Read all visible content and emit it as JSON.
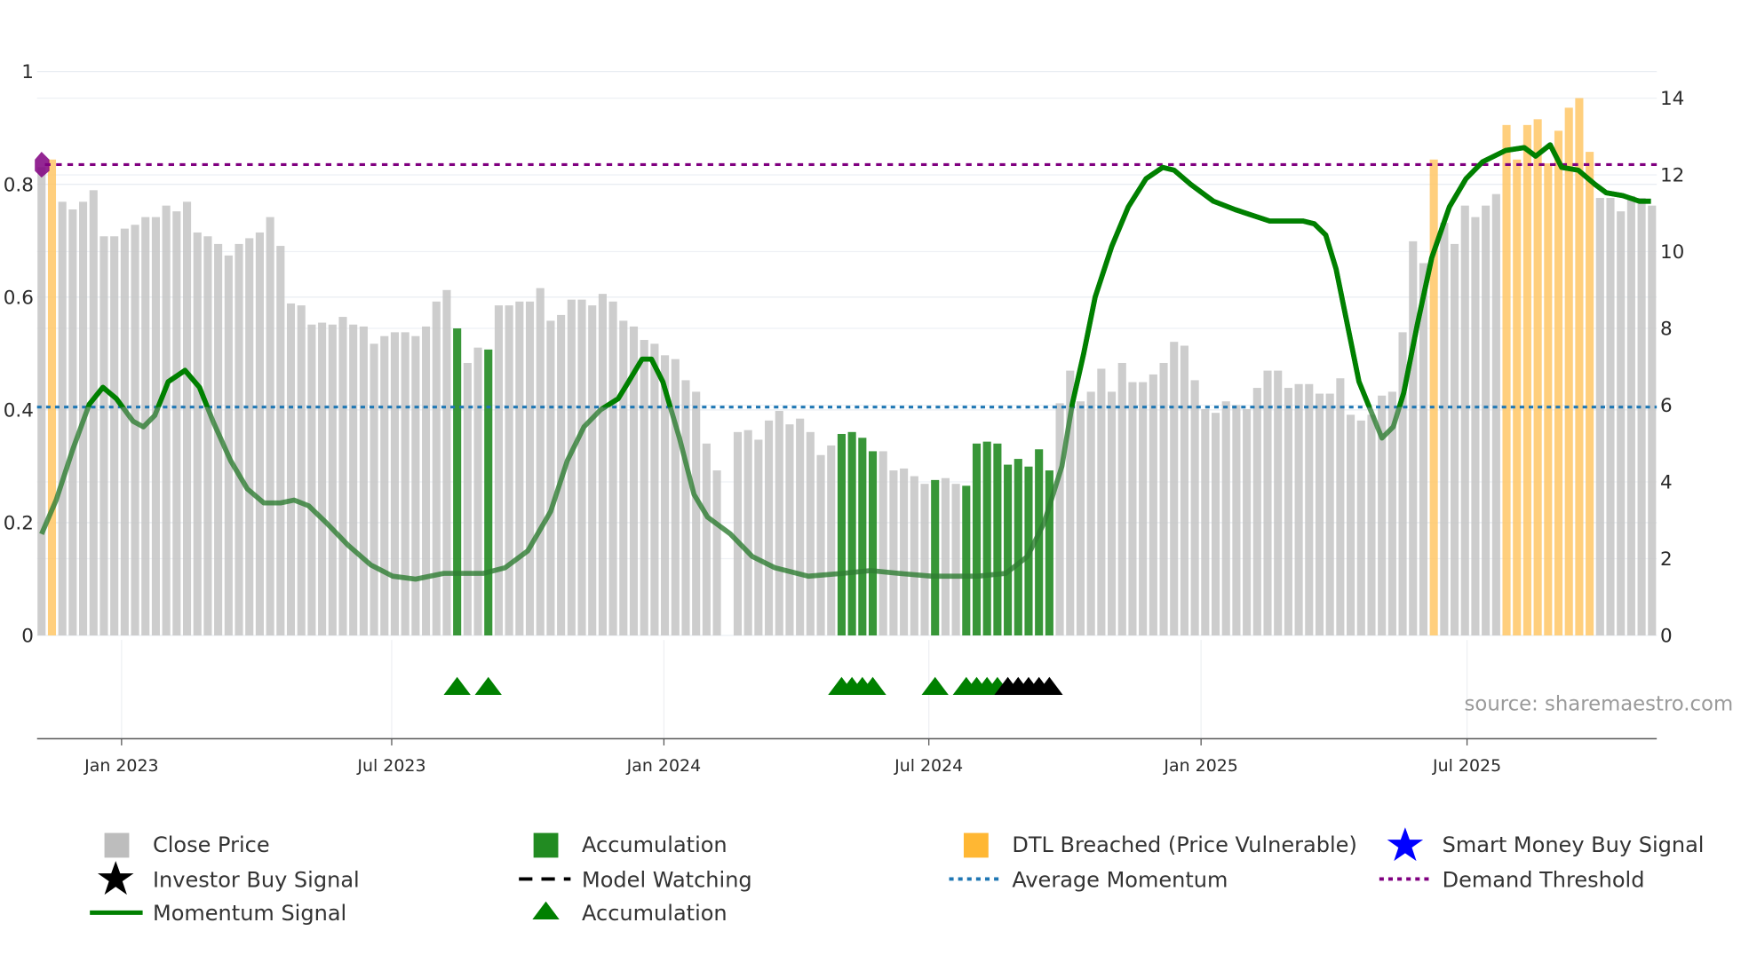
{
  "chart_data": {
    "type": "bar",
    "title": "",
    "x_unit": "week index",
    "left_axis": {
      "ticks": [
        "0",
        "0.2",
        "0.4",
        "0.6",
        "0.8",
        "1"
      ],
      "values": [
        0,
        0.2,
        0.4,
        0.6,
        0.8,
        1
      ],
      "range": [
        0,
        1
      ]
    },
    "right_axis": {
      "ticks": [
        "0",
        "2",
        "4",
        "6",
        "8",
        "10",
        "12",
        "14"
      ],
      "values": [
        0,
        2,
        4,
        6,
        8,
        10,
        12,
        14
      ],
      "range": [
        0,
        14.7
      ]
    },
    "x_ticks": [
      {
        "label": "Jan 2023",
        "x": 7.7
      },
      {
        "label": "Jul 2023",
        "x": 33.7
      },
      {
        "label": "Jan 2024",
        "x": 59.9
      },
      {
        "label": "Jul 2024",
        "x": 85.4
      },
      {
        "label": "Jan 2025",
        "x": 111.6
      },
      {
        "label": "Jul 2025",
        "x": 137.2
      }
    ],
    "close_price": [
      12.2,
      12.4,
      11.3,
      11.1,
      11.3,
      11.6,
      10.4,
      10.4,
      10.6,
      10.7,
      10.9,
      10.9,
      11.2,
      11.05,
      11.3,
      10.5,
      10.4,
      10.2,
      9.9,
      10.2,
      10.35,
      10.5,
      10.9,
      10.15,
      8.65,
      8.6,
      8.1,
      8.15,
      8.1,
      8.3,
      8.1,
      8.05,
      7.6,
      7.8,
      7.9,
      7.9,
      7.8,
      8.05,
      8.7,
      9.0,
      8.0,
      7.1,
      7.5,
      7.45,
      8.6,
      8.6,
      8.7,
      8.7,
      9.05,
      8.2,
      8.35,
      8.75,
      8.75,
      8.6,
      8.9,
      8.7,
      8.2,
      8.05,
      7.7,
      7.6,
      7.3,
      7.2,
      6.65,
      6.35,
      5.0,
      4.3,
      null,
      5.3,
      5.35,
      5.1,
      5.6,
      5.85,
      5.5,
      5.65,
      5.3,
      4.7,
      4.95,
      5.25,
      5.3,
      5.15,
      4.8,
      4.8,
      4.3,
      4.35,
      4.15,
      3.95,
      4.05,
      4.1,
      3.95,
      3.9,
      5.0,
      5.05,
      5.0,
      4.45,
      4.6,
      4.4,
      4.85,
      4.3,
      6.05,
      6.9,
      6.1,
      6.35,
      6.95,
      6.35,
      7.1,
      6.6,
      6.6,
      6.8,
      7.1,
      7.65,
      7.55,
      6.65,
      5.9,
      5.8,
      6.1,
      6.0,
      5.9,
      6.45,
      6.9,
      6.9,
      6.45,
      6.55,
      6.55,
      6.3,
      6.3,
      6.7,
      5.75,
      5.6,
      5.75,
      6.25,
      6.35,
      7.9,
      10.27,
      9.7,
      12.4,
      10.75,
      10.2,
      11.2,
      10.9,
      11.2,
      11.5,
      13.3,
      12.4,
      13.3,
      13.45,
      12.3,
      13.15,
      13.75,
      14.0,
      12.6,
      11.4,
      11.4,
      11.05,
      11.45,
      11.4,
      11.2
    ],
    "accumulation_bars": [
      40,
      43,
      77,
      78,
      79,
      80,
      86,
      89,
      90,
      91,
      92,
      93,
      94,
      95,
      96,
      97
    ],
    "dtl_breached_bars": [
      1,
      134,
      141,
      142,
      143,
      144,
      145,
      146,
      147,
      148,
      149
    ],
    "accumulation_triangles": [
      40,
      43,
      77,
      78,
      79,
      80,
      86,
      89,
      90,
      91,
      92
    ],
    "investor_buy_signals": [
      93,
      94,
      95,
      96,
      97
    ],
    "momentum_signal": [
      [
        0,
        0.18
      ],
      [
        1.4,
        0.24
      ],
      [
        3,
        0.33
      ],
      [
        4.6,
        0.41
      ],
      [
        5.9,
        0.44
      ],
      [
        7.2,
        0.42
      ],
      [
        8.8,
        0.38
      ],
      [
        9.8,
        0.37
      ],
      [
        10.9,
        0.39
      ],
      [
        12.2,
        0.45
      ],
      [
        13.8,
        0.47
      ],
      [
        15.2,
        0.44
      ],
      [
        16.5,
        0.38
      ],
      [
        18.2,
        0.31
      ],
      [
        19.8,
        0.26
      ],
      [
        21.4,
        0.235
      ],
      [
        23,
        0.235
      ],
      [
        24.3,
        0.24
      ],
      [
        25.7,
        0.23
      ],
      [
        27.4,
        0.2
      ],
      [
        29.5,
        0.16
      ],
      [
        31.7,
        0.125
      ],
      [
        33.8,
        0.105
      ],
      [
        36,
        0.1
      ],
      [
        38.7,
        0.11
      ],
      [
        42.5,
        0.11
      ],
      [
        44.6,
        0.12
      ],
      [
        46.8,
        0.15
      ],
      [
        49,
        0.22
      ],
      [
        50.6,
        0.31
      ],
      [
        52.2,
        0.37
      ],
      [
        53.8,
        0.4
      ],
      [
        55.5,
        0.42
      ],
      [
        56.5,
        0.45
      ],
      [
        57.8,
        0.49
      ],
      [
        58.7,
        0.49
      ],
      [
        59.8,
        0.45
      ],
      [
        61.4,
        0.35
      ],
      [
        62.8,
        0.25
      ],
      [
        64.1,
        0.21
      ],
      [
        66.3,
        0.18
      ],
      [
        68.4,
        0.14
      ],
      [
        70.6,
        0.12
      ],
      [
        73.8,
        0.105
      ],
      [
        77.1,
        0.11
      ],
      [
        79.8,
        0.115
      ],
      [
        82.5,
        0.11
      ],
      [
        85.7,
        0.105
      ],
      [
        90.1,
        0.105
      ],
      [
        92.8,
        0.11
      ],
      [
        94.9,
        0.14
      ],
      [
        96.5,
        0.2
      ],
      [
        98.2,
        0.3
      ],
      [
        99.2,
        0.41
      ],
      [
        100.3,
        0.5
      ],
      [
        101.4,
        0.6
      ],
      [
        103,
        0.69
      ],
      [
        104.6,
        0.76
      ],
      [
        106.3,
        0.81
      ],
      [
        107.9,
        0.83
      ],
      [
        109,
        0.825
      ],
      [
        110.6,
        0.8
      ],
      [
        112.8,
        0.77
      ],
      [
        114.9,
        0.755
      ],
      [
        118.2,
        0.735
      ],
      [
        121.4,
        0.735
      ],
      [
        122.5,
        0.73
      ],
      [
        123.6,
        0.71
      ],
      [
        124.6,
        0.65
      ],
      [
        125.7,
        0.55
      ],
      [
        126.8,
        0.45
      ],
      [
        127.9,
        0.4
      ],
      [
        129,
        0.35
      ],
      [
        130.1,
        0.37
      ],
      [
        131.1,
        0.43
      ],
      [
        132.4,
        0.55
      ],
      [
        133.8,
        0.67
      ],
      [
        135.5,
        0.76
      ],
      [
        137.1,
        0.81
      ],
      [
        138.7,
        0.84
      ],
      [
        140.9,
        0.86
      ],
      [
        142.7,
        0.865
      ],
      [
        143.8,
        0.85
      ],
      [
        145.2,
        0.87
      ],
      [
        146.3,
        0.83
      ],
      [
        147.9,
        0.825
      ],
      [
        149.5,
        0.8
      ],
      [
        150.6,
        0.785
      ],
      [
        152.2,
        0.78
      ],
      [
        153.8,
        0.77
      ],
      [
        154.9,
        0.77
      ]
    ],
    "average_momentum": 0.405,
    "demand_threshold": 0.835,
    "colors": {
      "close": "#c4c4c4",
      "accumulation": "#228b22",
      "dtl": "#ffc766",
      "momentum": "#008000",
      "average": "#1f77b4",
      "demand": "#800080",
      "smart_money": "#0000ff",
      "investor": "#000000"
    },
    "legend_position": "bottom"
  },
  "source": "source: sharemaestro.com",
  "legend": {
    "close_price": "Close Price",
    "accumulation_bar": "Accumulation",
    "dtl_breached": "DTL Breached (Price Vulnerable)",
    "smart_money": "Smart Money Buy Signal",
    "investor_buy": "Investor Buy Signal",
    "model_watching": "Model Watching",
    "average_momentum": "Average Momentum",
    "demand_threshold": "Demand Threshold",
    "momentum_signal": "Momentum Signal",
    "accumulation_triangle": "Accumulation"
  }
}
